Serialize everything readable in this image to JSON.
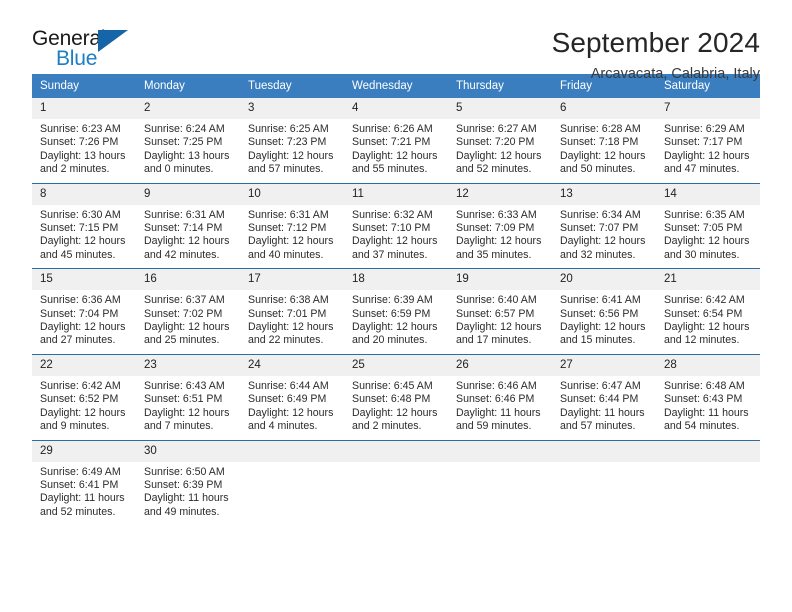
{
  "logo": {
    "word_one": "General",
    "word_two": "Blue",
    "triangle_color": "#1565a8",
    "blue_color": "#1c7fc4"
  },
  "header": {
    "month_title": "September 2024",
    "location": "Arcavacata, Calabria, Italy"
  },
  "theme": {
    "header_bg": "#3a7ebf",
    "week_divider": "#2d6da4",
    "daynum_bg": "#f0f0f0"
  },
  "weekdays": [
    "Sunday",
    "Monday",
    "Tuesday",
    "Wednesday",
    "Thursday",
    "Friday",
    "Saturday"
  ],
  "weeks": [
    [
      {
        "day": "1",
        "text": "Sunrise: 6:23 AM\nSunset: 7:26 PM\nDaylight: 13 hours\nand 2 minutes."
      },
      {
        "day": "2",
        "text": "Sunrise: 6:24 AM\nSunset: 7:25 PM\nDaylight: 13 hours\nand 0 minutes."
      },
      {
        "day": "3",
        "text": "Sunrise: 6:25 AM\nSunset: 7:23 PM\nDaylight: 12 hours\nand 57 minutes."
      },
      {
        "day": "4",
        "text": "Sunrise: 6:26 AM\nSunset: 7:21 PM\nDaylight: 12 hours\nand 55 minutes."
      },
      {
        "day": "5",
        "text": "Sunrise: 6:27 AM\nSunset: 7:20 PM\nDaylight: 12 hours\nand 52 minutes."
      },
      {
        "day": "6",
        "text": "Sunrise: 6:28 AM\nSunset: 7:18 PM\nDaylight: 12 hours\nand 50 minutes."
      },
      {
        "day": "7",
        "text": "Sunrise: 6:29 AM\nSunset: 7:17 PM\nDaylight: 12 hours\nand 47 minutes."
      }
    ],
    [
      {
        "day": "8",
        "text": "Sunrise: 6:30 AM\nSunset: 7:15 PM\nDaylight: 12 hours\nand 45 minutes."
      },
      {
        "day": "9",
        "text": "Sunrise: 6:31 AM\nSunset: 7:14 PM\nDaylight: 12 hours\nand 42 minutes."
      },
      {
        "day": "10",
        "text": "Sunrise: 6:31 AM\nSunset: 7:12 PM\nDaylight: 12 hours\nand 40 minutes."
      },
      {
        "day": "11",
        "text": "Sunrise: 6:32 AM\nSunset: 7:10 PM\nDaylight: 12 hours\nand 37 minutes."
      },
      {
        "day": "12",
        "text": "Sunrise: 6:33 AM\nSunset: 7:09 PM\nDaylight: 12 hours\nand 35 minutes."
      },
      {
        "day": "13",
        "text": "Sunrise: 6:34 AM\nSunset: 7:07 PM\nDaylight: 12 hours\nand 32 minutes."
      },
      {
        "day": "14",
        "text": "Sunrise: 6:35 AM\nSunset: 7:05 PM\nDaylight: 12 hours\nand 30 minutes."
      }
    ],
    [
      {
        "day": "15",
        "text": "Sunrise: 6:36 AM\nSunset: 7:04 PM\nDaylight: 12 hours\nand 27 minutes."
      },
      {
        "day": "16",
        "text": "Sunrise: 6:37 AM\nSunset: 7:02 PM\nDaylight: 12 hours\nand 25 minutes."
      },
      {
        "day": "17",
        "text": "Sunrise: 6:38 AM\nSunset: 7:01 PM\nDaylight: 12 hours\nand 22 minutes."
      },
      {
        "day": "18",
        "text": "Sunrise: 6:39 AM\nSunset: 6:59 PM\nDaylight: 12 hours\nand 20 minutes."
      },
      {
        "day": "19",
        "text": "Sunrise: 6:40 AM\nSunset: 6:57 PM\nDaylight: 12 hours\nand 17 minutes."
      },
      {
        "day": "20",
        "text": "Sunrise: 6:41 AM\nSunset: 6:56 PM\nDaylight: 12 hours\nand 15 minutes."
      },
      {
        "day": "21",
        "text": "Sunrise: 6:42 AM\nSunset: 6:54 PM\nDaylight: 12 hours\nand 12 minutes."
      }
    ],
    [
      {
        "day": "22",
        "text": "Sunrise: 6:42 AM\nSunset: 6:52 PM\nDaylight: 12 hours\nand 9 minutes."
      },
      {
        "day": "23",
        "text": "Sunrise: 6:43 AM\nSunset: 6:51 PM\nDaylight: 12 hours\nand 7 minutes."
      },
      {
        "day": "24",
        "text": "Sunrise: 6:44 AM\nSunset: 6:49 PM\nDaylight: 12 hours\nand 4 minutes."
      },
      {
        "day": "25",
        "text": "Sunrise: 6:45 AM\nSunset: 6:48 PM\nDaylight: 12 hours\nand 2 minutes."
      },
      {
        "day": "26",
        "text": "Sunrise: 6:46 AM\nSunset: 6:46 PM\nDaylight: 11 hours\nand 59 minutes."
      },
      {
        "day": "27",
        "text": "Sunrise: 6:47 AM\nSunset: 6:44 PM\nDaylight: 11 hours\nand 57 minutes."
      },
      {
        "day": "28",
        "text": "Sunrise: 6:48 AM\nSunset: 6:43 PM\nDaylight: 11 hours\nand 54 minutes."
      }
    ],
    [
      {
        "day": "29",
        "text": "Sunrise: 6:49 AM\nSunset: 6:41 PM\nDaylight: 11 hours\nand 52 minutes."
      },
      {
        "day": "30",
        "text": "Sunrise: 6:50 AM\nSunset: 6:39 PM\nDaylight: 11 hours\nand 49 minutes."
      },
      {
        "day": "",
        "text": ""
      },
      {
        "day": "",
        "text": ""
      },
      {
        "day": "",
        "text": ""
      },
      {
        "day": "",
        "text": ""
      },
      {
        "day": "",
        "text": ""
      }
    ]
  ]
}
